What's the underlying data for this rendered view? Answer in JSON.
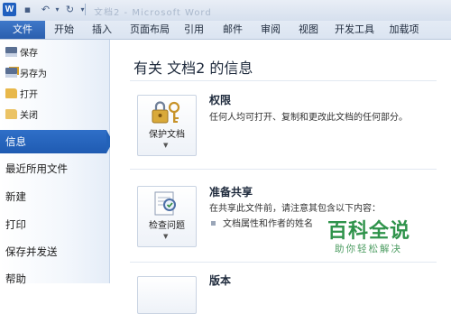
{
  "titlebar": {
    "app_icon": "W",
    "document_title": "文档2 - Microsoft Word",
    "quick_access": [
      {
        "name": "save-icon",
        "glyph": "▪"
      },
      {
        "name": "undo-icon",
        "glyph": "↶"
      },
      {
        "name": "undo-dropdown-icon",
        "glyph": "▾"
      },
      {
        "name": "redo-icon",
        "glyph": "↻"
      },
      {
        "name": "customize-qa-icon",
        "glyph": "▾"
      }
    ]
  },
  "ribbon": {
    "file_tab": "文件",
    "tabs": [
      "开始",
      "插入",
      "页面布局",
      "引用",
      "邮件",
      "审阅",
      "视图",
      "开发工具",
      "加载项"
    ]
  },
  "backstage": {
    "commands": [
      {
        "label": "保存",
        "icon": "save-icon"
      },
      {
        "label": "另存为",
        "icon": "save-as-icon"
      },
      {
        "label": "打开",
        "icon": "open-folder-icon"
      },
      {
        "label": "关闭",
        "icon": "close-folder-icon"
      }
    ],
    "items": [
      "信息",
      "最近所用文件",
      "新建",
      "打印",
      "保存并发送",
      "帮助"
    ],
    "active_item": "信息"
  },
  "info": {
    "title": "有关 文档2 的信息",
    "permissions": {
      "button_label": "保护文档",
      "icon": "lock-keys-icon",
      "heading": "权限",
      "description": "任何人均可打开、复制和更改此文档的任何部分。"
    },
    "prepare": {
      "button_label": "检查问题",
      "icon": "inspect-document-icon",
      "heading": "准备共享",
      "description": "在共享此文件前，请注意其包含以下内容：",
      "bullet": "文档属性和作者的姓名"
    },
    "versions": {
      "heading": "版本"
    }
  },
  "watermark": {
    "main": "百科全说",
    "sub": "助你轻松解决"
  },
  "colors": {
    "file_tab": "#2b5fae",
    "active_nav": "#2362b8",
    "watermark": "#1e8a3c"
  }
}
